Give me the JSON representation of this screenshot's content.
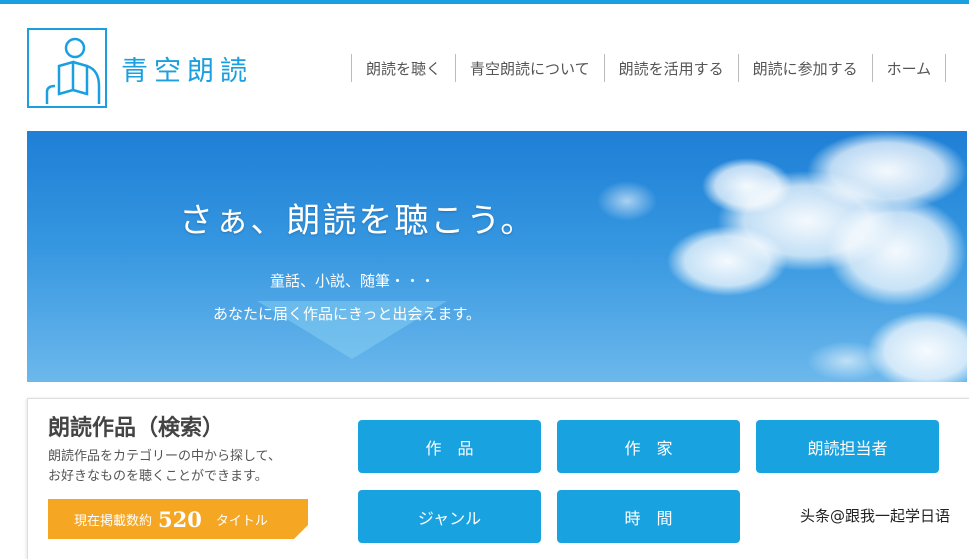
{
  "brand": {
    "name": "青空朗読",
    "color": "#1aa0e0"
  },
  "nav": {
    "items": [
      "朗読を聴く",
      "青空朗読について",
      "朗読を活用する",
      "朗読に参加する",
      "ホーム"
    ]
  },
  "hero": {
    "title": "さぁ、朗読を聴こう。",
    "line1": "童話、小説、随筆・・・",
    "line2": "あなたに届く作品にきっと出会えます。"
  },
  "search": {
    "title": "朗読作品（検索）",
    "desc1": "朗読作品をカテゴリーの中から探して、",
    "desc2": "お好きなものを聴くことができます。",
    "count_prefix": "現在掲載数約",
    "count": "520",
    "count_suffix": "タイトル",
    "buttons": [
      "作　品",
      "作　家",
      "朗読担当者",
      "ジャンル",
      "時　間"
    ]
  },
  "watermark": "头条@跟我一起学日语",
  "colors": {
    "accent": "#1aa0e0",
    "button": "#18a2df",
    "badge": "#f5a623"
  }
}
